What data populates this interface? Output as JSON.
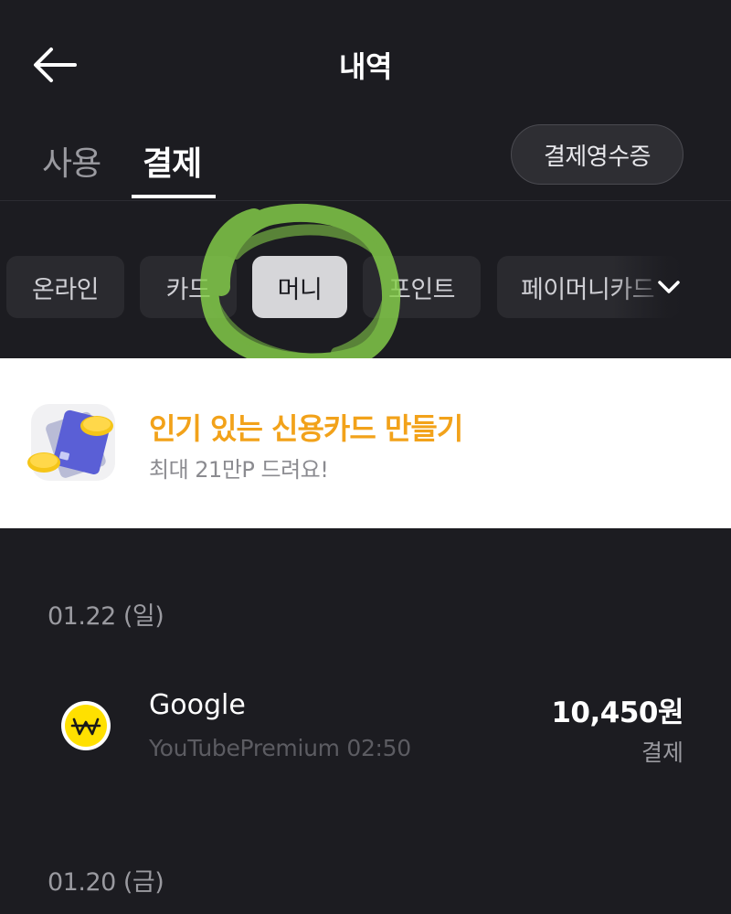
{
  "header": {
    "title": "내역",
    "back_icon": "arrow-left-icon"
  },
  "tabs": {
    "items": [
      {
        "label": "사용",
        "active": false
      },
      {
        "label": "결제",
        "active": true
      }
    ],
    "receipt_label": "결제영수증"
  },
  "chips": {
    "items": [
      {
        "label": "온라인",
        "selected": false
      },
      {
        "label": "카드",
        "selected": false
      },
      {
        "label": "머니",
        "selected": true
      },
      {
        "label": "포인트",
        "selected": false
      },
      {
        "label": "페이머니카드",
        "selected": false
      }
    ],
    "expand_icon": "chevron-down-icon"
  },
  "banner": {
    "title": "인기 있는 신용카드 만들기",
    "subtitle": "최대 21만P 드려요!",
    "icon": "credit-card-coins-icon",
    "title_color": "#f2a21a"
  },
  "groups": [
    {
      "date": "01.22 (일)",
      "transactions": [
        {
          "merchant": "Google",
          "detail": "YouTubePremium 02:50",
          "amount": "10,450원",
          "type": "결제",
          "icon": "won-coin-icon"
        }
      ]
    },
    {
      "date": "01.20 (금)",
      "transactions": []
    }
  ],
  "colors": {
    "background": "#1c1c21",
    "chip_selected": "#d6d6d9",
    "accent_yellow": "#ffe000",
    "annotation_green": "#86d04a"
  }
}
